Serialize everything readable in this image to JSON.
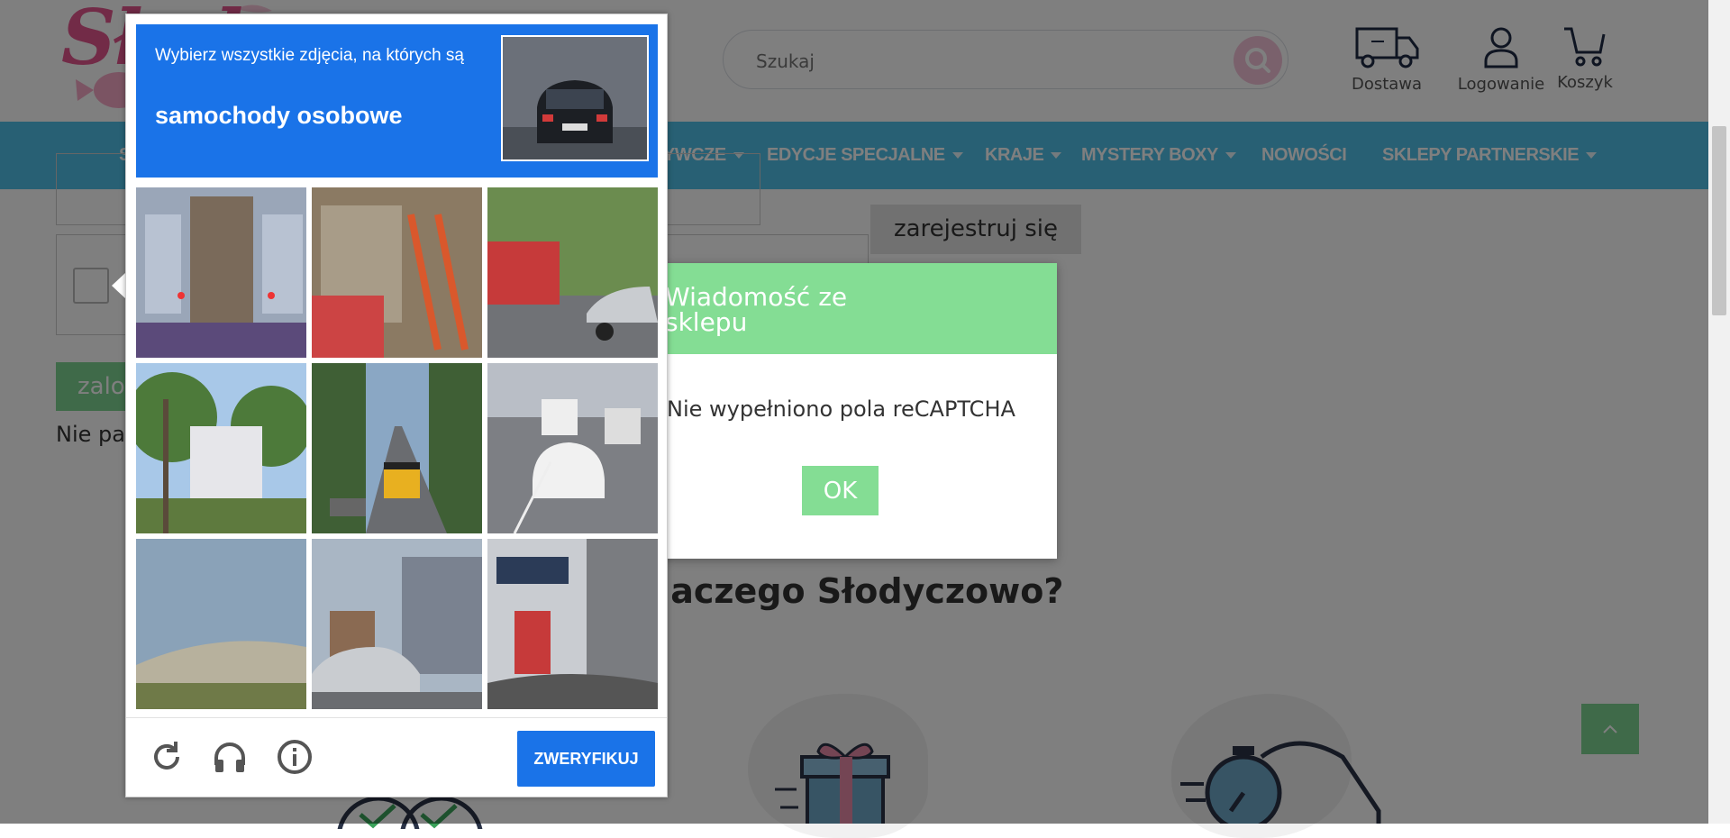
{
  "header": {
    "logo_text": "Słodyczowo",
    "search_placeholder": "Szukaj",
    "icons": [
      {
        "name": "delivery-truck-icon",
        "label": "Dostawa"
      },
      {
        "name": "user-icon",
        "label": "Logowanie"
      },
      {
        "name": "cart-icon",
        "label": "Koszyk"
      }
    ]
  },
  "nav": {
    "items": [
      {
        "label": "S",
        "dropdown": false
      },
      {
        "label": "YWCZE",
        "dropdown": true
      },
      {
        "label": "EDYCJE SPECJALNE",
        "dropdown": true
      },
      {
        "label": "KRAJE",
        "dropdown": true
      },
      {
        "label": "MYSTERY BOXY",
        "dropdown": true
      },
      {
        "label": "NOWOŚCI",
        "dropdown": false
      },
      {
        "label": "SKLEPY PARTNERSKIE",
        "dropdown": true
      }
    ]
  },
  "page": {
    "login_button": "zalo",
    "forgot_text": "Nie pa",
    "register_button": "zarejestruj się",
    "why_heading": "Dlaczego Słodyczowo?"
  },
  "alert": {
    "title": "Wiadomość ze sklepu",
    "message": "Nie wypełniono pola reCAPTCHA",
    "ok_label": "OK"
  },
  "captcha": {
    "prompt": "Wybierz wszystkie zdjęcia, na których są",
    "target": "samochody osobowe",
    "verify_label": "ZWERYFIKUJ",
    "footer_icons": [
      "reload-icon",
      "audio-challenge-icon",
      "info-icon"
    ]
  },
  "colors": {
    "nav_bg": "#50c0e8",
    "brand_pink": "#e4578f",
    "captcha_blue": "#1a73e8",
    "alert_green": "#84dd94"
  }
}
